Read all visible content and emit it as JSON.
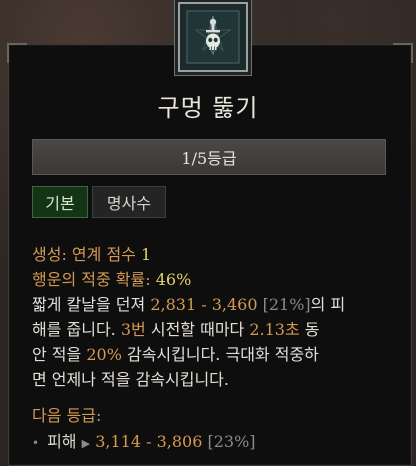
{
  "skill": {
    "title": "구멍 뚫기",
    "rank": "1/5등급",
    "tabs": {
      "basic": "기본",
      "master": "명사수"
    },
    "generate_label": "생성: 연계 점수 ",
    "generate_value": "1",
    "lucky_label": "행운의 적중 확률: ",
    "lucky_value": "46%",
    "desc1_a": "짧게 칼날을 던져 ",
    "desc1_range": "2,831 - 3,460",
    "desc1_pct": " [21%]",
    "desc1_b": "의 피",
    "desc2_a": "해를 줍니다. ",
    "desc2_hits": "3번",
    "desc2_b": " 시전할 때마다 ",
    "desc2_secs": "2.13초",
    "desc2_c": " 동",
    "desc3_a": "안 적을 ",
    "desc3_pct": "20%",
    "desc3_b": " 감속시킵니다. 극대화 적중하",
    "desc4": "면 언제나 적을 감속시킵니다.",
    "next_label": "다음 등급:",
    "next_bullet": "•",
    "next_stat": "피해",
    "next_arrow": "▶",
    "next_range": "3,114 - 3,806",
    "next_pct": "[23%]"
  },
  "colors": {
    "accent": "#d39a52",
    "highlight": "#e2d26a",
    "tab_active": "#153315"
  },
  "icons": {
    "emblem": "dagger-skull-icon"
  }
}
